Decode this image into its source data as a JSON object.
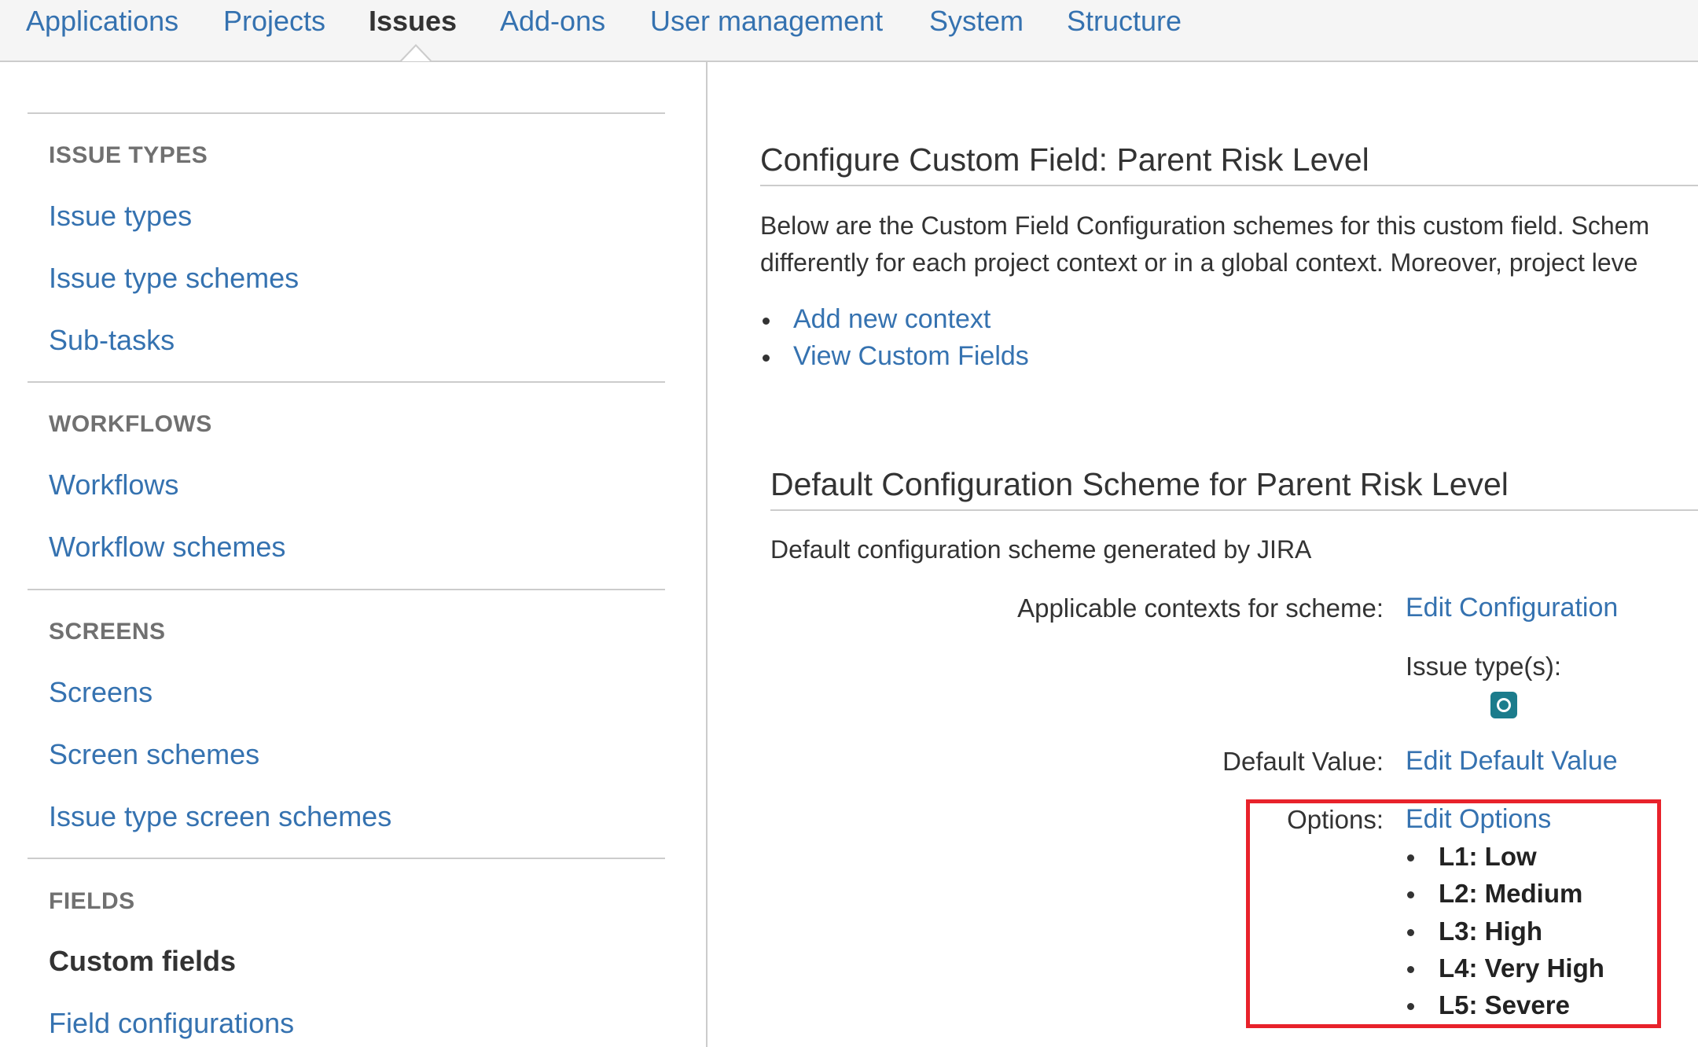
{
  "topnav": {
    "tabs": [
      {
        "label": "Applications"
      },
      {
        "label": "Projects"
      },
      {
        "label": "Issues",
        "active": true
      },
      {
        "label": "Add-ons"
      },
      {
        "label": "User management"
      },
      {
        "label": "System"
      },
      {
        "label": "Structure"
      }
    ]
  },
  "sidebar": {
    "sections": [
      {
        "heading": "ISSUE TYPES",
        "items": [
          "Issue types",
          "Issue type schemes",
          "Sub-tasks"
        ]
      },
      {
        "heading": "WORKFLOWS",
        "items": [
          "Workflows",
          "Workflow schemes"
        ]
      },
      {
        "heading": "SCREENS",
        "items": [
          "Screens",
          "Screen schemes",
          "Issue type screen schemes"
        ]
      },
      {
        "heading": "FIELDS",
        "items": [
          "Custom fields",
          "Field configurations"
        ],
        "current_item": "Custom fields"
      }
    ]
  },
  "main": {
    "title": "Configure Custom Field: Parent Risk Level",
    "description_line1": "Below are the Custom Field Configuration schemes for this custom field. Schem",
    "description_line2": "differently for each project context or in a global context. Moreover, project leve",
    "actions": [
      "Add new context",
      "View Custom Fields"
    ],
    "scheme": {
      "title": "Default Configuration Scheme for Parent Risk Level",
      "description": "Default configuration scheme generated by JIRA",
      "contexts_label": "Applicable contexts for scheme:",
      "contexts_link": "Edit Configuration",
      "issue_types_label": "Issue type(s):",
      "issue_type_icon": "subtask-icon",
      "default_value_label": "Default Value:",
      "default_value_link": "Edit Default Value",
      "options_label": "Options:",
      "options_link": "Edit Options",
      "options": [
        "L1: Low",
        "L2: Medium",
        "L3: High",
        "L4: Very High",
        "L5: Severe"
      ]
    }
  },
  "colors": {
    "link": "#3572b0",
    "text": "#333333",
    "highlight": "#e8222b",
    "issue_icon": "#1c7c8c"
  }
}
